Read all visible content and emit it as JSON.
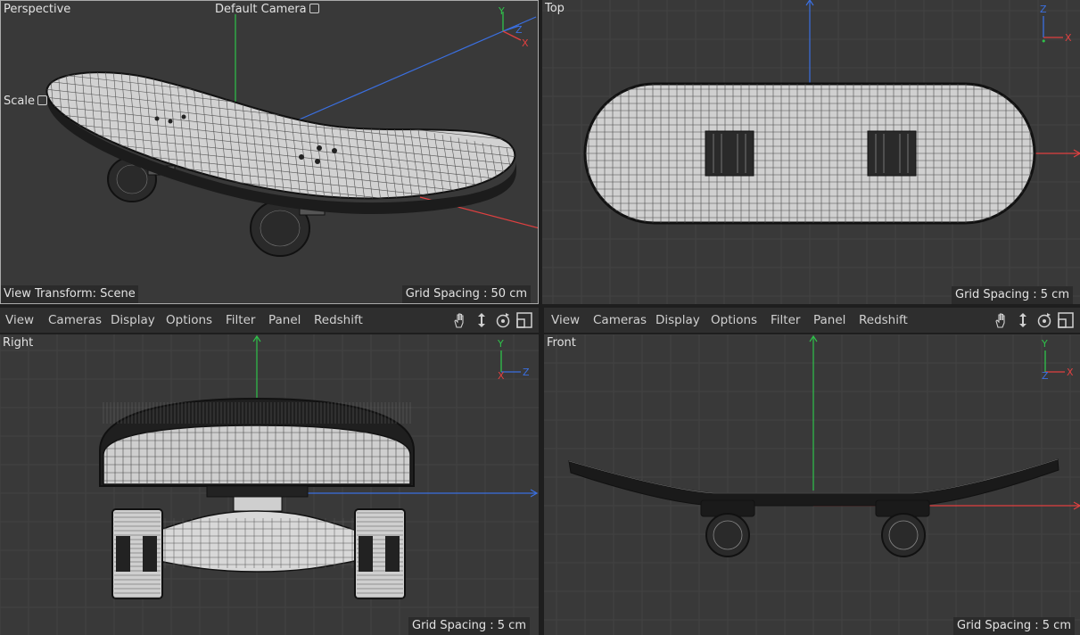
{
  "colors": {
    "viewport_bg": "#393939",
    "grid_line": "#444444",
    "x_axis": "#e04040",
    "y_axis": "#2fc24a",
    "z_axis": "#3a6fe0",
    "active_border": "#aaaaaa"
  },
  "perspective": {
    "title": "Perspective",
    "camera_label": "Default Camera",
    "scale_label": "Scale",
    "view_transform": "View Transform: Scene",
    "grid_spacing": "Grid Spacing : 50 cm"
  },
  "top": {
    "title": "Top",
    "grid_spacing": "Grid Spacing : 5 cm"
  },
  "right": {
    "title": "Right",
    "grid_spacing": "Grid Spacing : 5 cm"
  },
  "front": {
    "title": "Front",
    "grid_spacing": "Grid Spacing : 5 cm"
  },
  "menu": {
    "items": [
      "View",
      "Cameras",
      "Display",
      "Options",
      "Filter",
      "Panel",
      "Redshift"
    ],
    "tool_icons": [
      "pan-hand-icon",
      "move-arrows-icon",
      "rotate-icon",
      "maximize-icon"
    ]
  },
  "gizmo": {
    "x": "X",
    "y": "Y",
    "z": "Z"
  }
}
